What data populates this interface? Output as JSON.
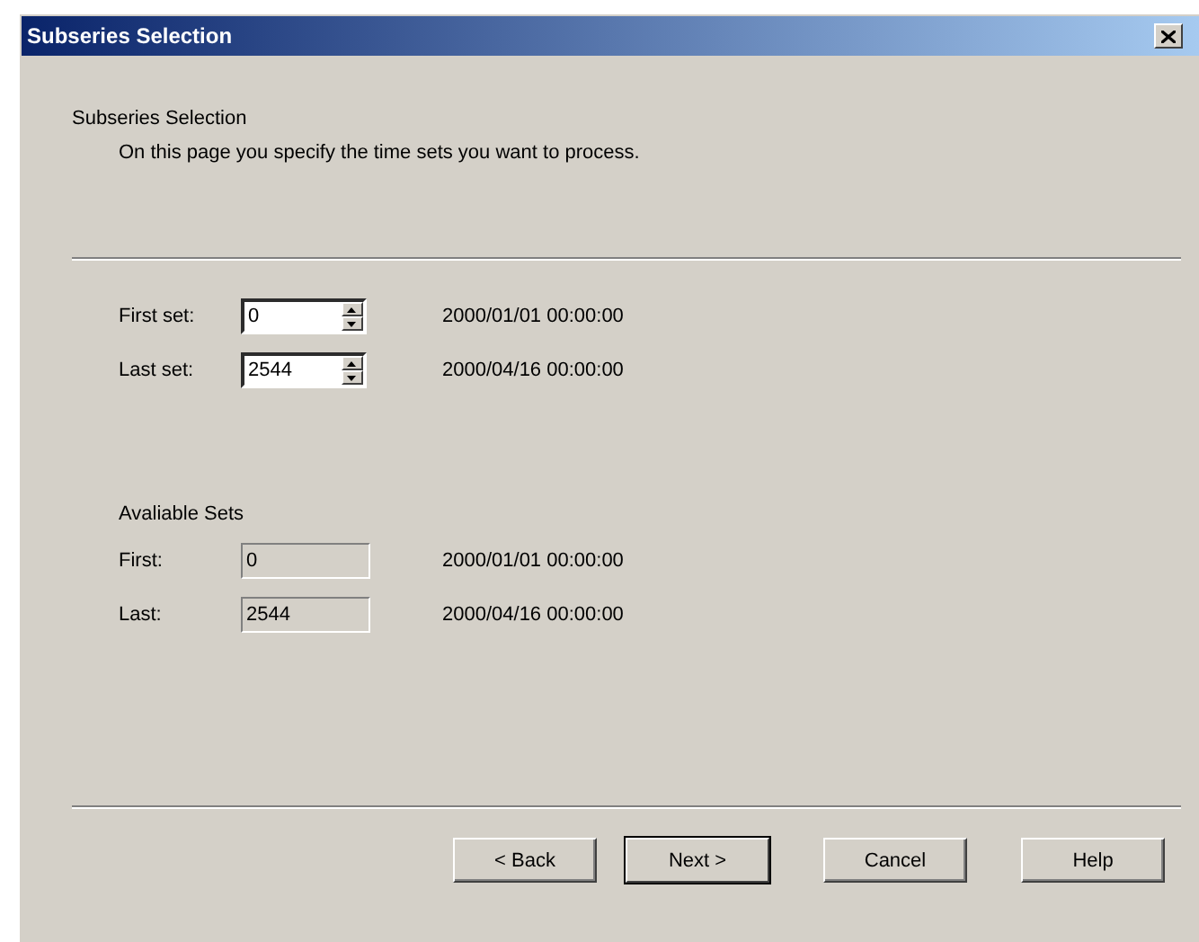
{
  "window": {
    "title": "Subseries Selection"
  },
  "header": {
    "title": "Subseries Selection",
    "subtitle": "On this page you specify the time sets you want to process."
  },
  "selection": [
    {
      "label": "First set:",
      "value": "0",
      "date": "2000/01/01 00:00:00"
    },
    {
      "label": "Last set:",
      "value": "2544",
      "date": "2000/04/16 00:00:00"
    }
  ],
  "available": {
    "title": "Avaliable Sets",
    "rows": [
      {
        "label": "First:",
        "value": "0",
        "date": "2000/01/01 00:00:00"
      },
      {
        "label": "Last:",
        "value": "2544",
        "date": "2000/04/16 00:00:00"
      }
    ]
  },
  "buttons": [
    {
      "label": "< Back",
      "default": false
    },
    {
      "label": "Next >",
      "default": true
    },
    {
      "label": "Cancel",
      "default": false
    },
    {
      "label": "Help",
      "default": false
    }
  ]
}
